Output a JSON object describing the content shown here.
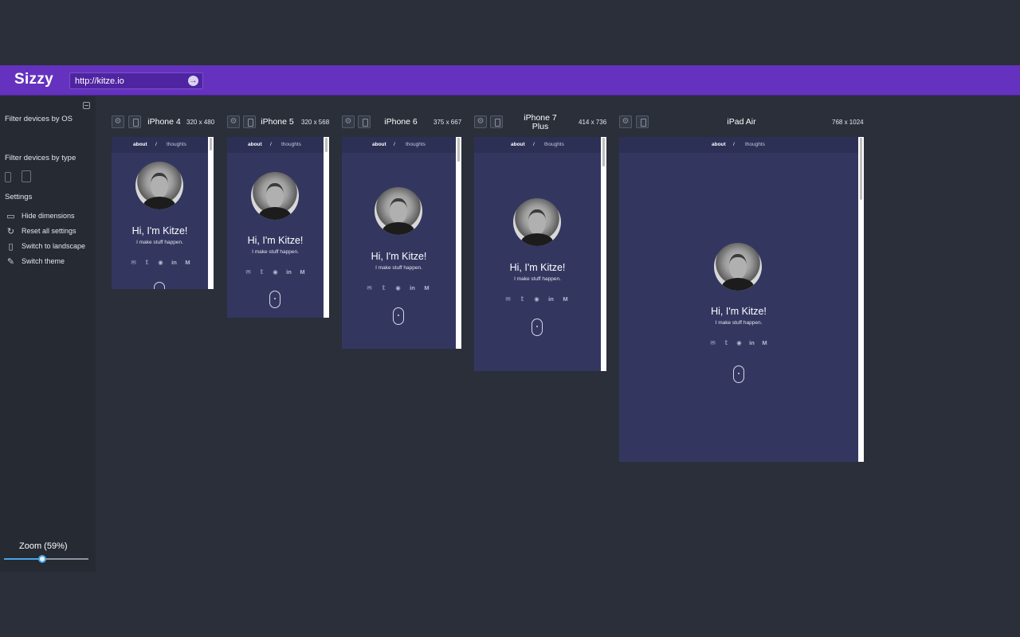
{
  "app": {
    "name": "Sizzy"
  },
  "url_bar": {
    "value": "http://kitze.io",
    "go_icon": "arrow-right-circle-icon"
  },
  "sidebar": {
    "filter_os_label": "Filter devices by OS",
    "filter_type_label": "Filter devices by type",
    "settings_label": "Settings",
    "settings": [
      {
        "label": "Hide dimensions",
        "icon": "monitor-icon"
      },
      {
        "label": "Reset all settings",
        "icon": "refresh-icon"
      },
      {
        "label": "Switch to landscape",
        "icon": "phone-icon"
      },
      {
        "label": "Switch theme",
        "icon": "brush-icon"
      }
    ],
    "zoom_label": "Zoom  (59%)",
    "zoom_value": 0.45
  },
  "site": {
    "nav_about": "about",
    "nav_sep": "/",
    "nav_thoughts": "thoughts",
    "greeting": "Hi, I'm Kitze!",
    "tagline": "I make stuff happen.",
    "socials": [
      "email-icon",
      "twitter-icon",
      "github-icon",
      "linkedin-icon",
      "medium-icon"
    ]
  },
  "devices": [
    {
      "name": "iPhone 4",
      "dims": "320 x 480"
    },
    {
      "name": "iPhone 5",
      "dims": "320 x 568"
    },
    {
      "name": "iPhone 6",
      "dims": "375 x 667"
    },
    {
      "name": "iPhone 7 Plus",
      "dims": "414 x 736"
    },
    {
      "name": "iPad Air",
      "dims": "768 x 1024"
    }
  ],
  "colors": {
    "header": "#6532bf",
    "background": "#2a2f3a",
    "sidebar": "#252a33",
    "site_bg": "#333760",
    "zoom_accent": "#4aa3e8"
  }
}
